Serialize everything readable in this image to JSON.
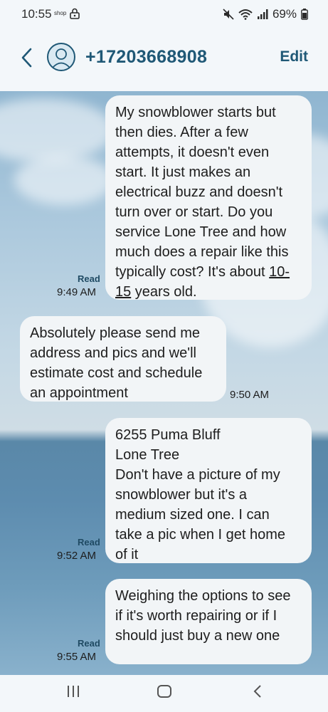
{
  "status_bar": {
    "time": "10:55",
    "shop_label": "shop",
    "battery": "69%"
  },
  "header": {
    "contact": "+17203668908",
    "edit_label": "Edit"
  },
  "messages": [
    {
      "direction": "out",
      "text_parts": [
        "My snowblower starts but then dies.  After a few attempts, it doesn't even start.  It just makes an electrical buzz and doesn't turn over or start.  Do you service Lone Tree and how much does a repair like this typically cost?  It's about ",
        "10-15",
        " years old."
      ],
      "status": "Read",
      "time": "9:49 AM"
    },
    {
      "direction": "in",
      "text": "Absolutely please send me address and pics and we'll estimate cost and schedule an appointment",
      "time": "9:50 AM"
    },
    {
      "direction": "out",
      "lines": [
        "6255 Puma Bluff",
        "Lone Tree",
        "Don't have a picture of my snowblower but it's a medium sized one.  I can take a pic when I get home of it"
      ],
      "status": "Read",
      "time": "9:52 AM"
    },
    {
      "direction": "out",
      "text": "Weighing the options to see if it's worth repairing or if I should just buy a new one",
      "status": "Read",
      "time": "9:55 AM"
    }
  ],
  "colors": {
    "accent": "#1f5876",
    "bubble": "#f2f5f7"
  }
}
